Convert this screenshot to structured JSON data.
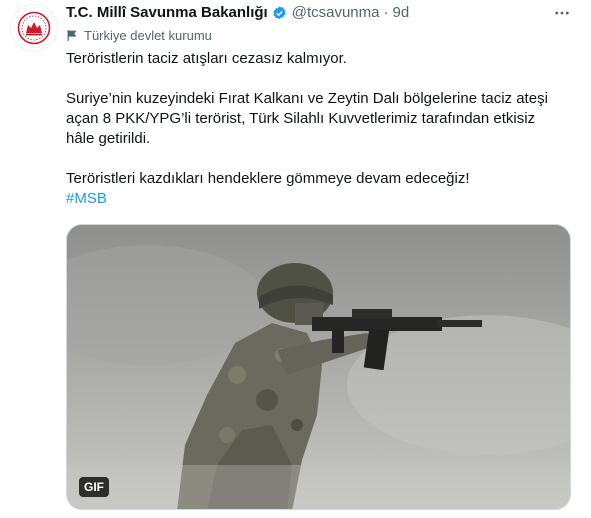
{
  "account": {
    "name": "T.C. Millî Savunma Bakanlığı",
    "handle": "@tcsavunma",
    "separator": "·",
    "time": "9d",
    "affiliation": "Türkiye devlet kurumu"
  },
  "tweet": {
    "line1": "Teröristlerin taciz atışları cezasız kalmıyor.",
    "line2": "Suriye’nin kuzeyindeki Fırat Kalkanı ve Zeytin Dalı bölgelerine taciz ateşi açan 8 PKK/YPG’li terörist, Türk Silahlı Kuvvetlerimiz tarafından etkisiz hâle getirildi.",
    "line3": "Teröristleri kazdıkları hendeklere gömmeye devam edeceğiz!",
    "hashtag": "#MSB"
  },
  "media": {
    "badge": "GIF"
  },
  "icons": {
    "avatar": "ministry-emblem-icon",
    "verified": "verified-badge-icon",
    "affiliation": "government-flag-icon",
    "more": "more-options-icon"
  },
  "colors": {
    "accent": "#1d9bf0",
    "emblem": "#d2182a",
    "muted": "#536471"
  }
}
